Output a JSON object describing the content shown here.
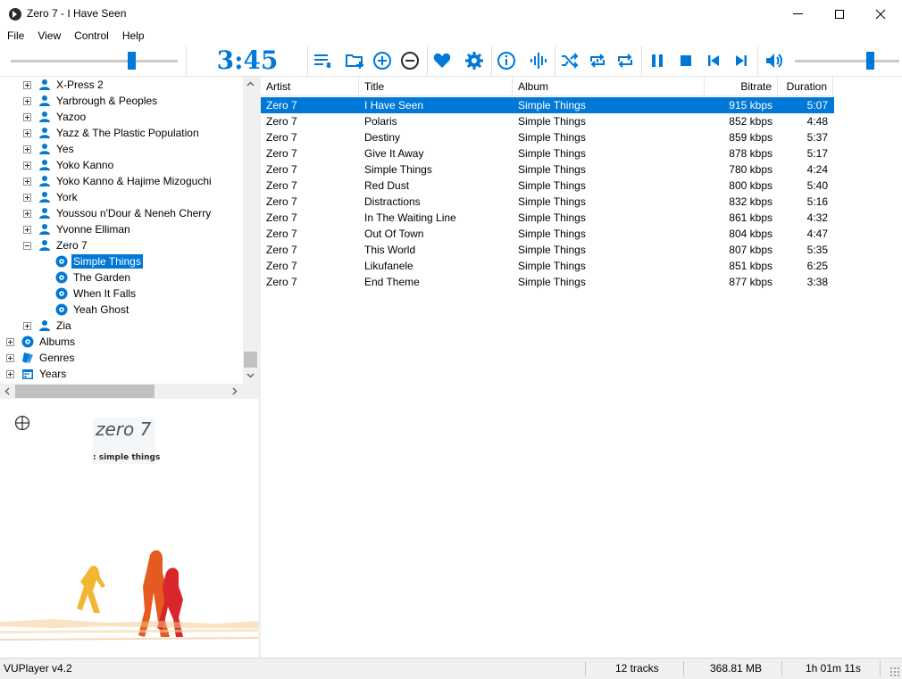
{
  "window": {
    "title": "Zero 7 - I Have Seen"
  },
  "menu": [
    "File",
    "View",
    "Control",
    "Help"
  ],
  "toolbar": {
    "counter": "3:45",
    "seek_fraction": 0.72,
    "volume_fraction": 0.72,
    "buttons": [
      "playlist-icon",
      "add-folder-icon",
      "add-icon",
      "remove-icon",
      "favourite-icon",
      "settings-icon",
      "info-icon",
      "visualiser-icon",
      "shuffle-icon",
      "repeat-track-icon",
      "repeat-playlist-icon",
      "pause-icon",
      "stop-icon",
      "previous-icon",
      "next-icon",
      "volume-icon"
    ],
    "accent": "#0078d7"
  },
  "tree": {
    "items": [
      {
        "label": "X-Press 2",
        "type": "artist",
        "expand": "plus",
        "level": 1
      },
      {
        "label": "Yarbrough & Peoples",
        "type": "artist",
        "expand": "plus",
        "level": 1
      },
      {
        "label": "Yazoo",
        "type": "artist",
        "expand": "plus",
        "level": 1
      },
      {
        "label": "Yazz & The Plastic Population",
        "type": "artist",
        "expand": "plus",
        "level": 1
      },
      {
        "label": "Yes",
        "type": "artist",
        "expand": "plus",
        "level": 1
      },
      {
        "label": "Yoko Kanno",
        "type": "artist",
        "expand": "plus",
        "level": 1
      },
      {
        "label": "Yoko Kanno & Hajime Mizoguchi",
        "type": "artist",
        "expand": "plus",
        "level": 1
      },
      {
        "label": "York",
        "type": "artist",
        "expand": "plus",
        "level": 1
      },
      {
        "label": "Youssou n'Dour & Neneh Cherry",
        "type": "artist",
        "expand": "plus",
        "level": 1
      },
      {
        "label": "Yvonne Elliman",
        "type": "artist",
        "expand": "plus",
        "level": 1
      },
      {
        "label": "Zero 7",
        "type": "artist",
        "expand": "minus",
        "level": 1
      },
      {
        "label": "Simple Things",
        "type": "album",
        "expand": "none",
        "level": 2,
        "selected": true
      },
      {
        "label": "The Garden",
        "type": "album",
        "expand": "none",
        "level": 2
      },
      {
        "label": "When It Falls",
        "type": "album",
        "expand": "none",
        "level": 2
      },
      {
        "label": "Yeah Ghost",
        "type": "album",
        "expand": "none",
        "level": 2
      },
      {
        "label": "Zia",
        "type": "artist",
        "expand": "plus",
        "level": 1
      },
      {
        "label": "Albums",
        "type": "albums",
        "expand": "plus",
        "level": 0
      },
      {
        "label": "Genres",
        "type": "genres",
        "expand": "plus",
        "level": 0
      },
      {
        "label": "Years",
        "type": "years",
        "expand": "plus",
        "level": 0
      }
    ]
  },
  "artwork": {
    "brand": "zero 7",
    "subtitle": ": simple things"
  },
  "playlist": {
    "columns": [
      "Artist",
      "Title",
      "Album",
      "Bitrate",
      "Duration"
    ],
    "rows": [
      {
        "artist": "Zero 7",
        "title": "I Have Seen",
        "album": "Simple Things",
        "bitrate": "915 kbps",
        "duration": "5:07",
        "selected": true
      },
      {
        "artist": "Zero 7",
        "title": "Polaris",
        "album": "Simple Things",
        "bitrate": "852 kbps",
        "duration": "4:48"
      },
      {
        "artist": "Zero 7",
        "title": "Destiny",
        "album": "Simple Things",
        "bitrate": "859 kbps",
        "duration": "5:37"
      },
      {
        "artist": "Zero 7",
        "title": "Give It Away",
        "album": "Simple Things",
        "bitrate": "878 kbps",
        "duration": "5:17"
      },
      {
        "artist": "Zero 7",
        "title": "Simple Things",
        "album": "Simple Things",
        "bitrate": "780 kbps",
        "duration": "4:24"
      },
      {
        "artist": "Zero 7",
        "title": "Red Dust",
        "album": "Simple Things",
        "bitrate": "800 kbps",
        "duration": "5:40"
      },
      {
        "artist": "Zero 7",
        "title": "Distractions",
        "album": "Simple Things",
        "bitrate": "832 kbps",
        "duration": "5:16"
      },
      {
        "artist": "Zero 7",
        "title": "In The Waiting Line",
        "album": "Simple Things",
        "bitrate": "861 kbps",
        "duration": "4:32"
      },
      {
        "artist": "Zero 7",
        "title": "Out Of Town",
        "album": "Simple Things",
        "bitrate": "804 kbps",
        "duration": "4:47"
      },
      {
        "artist": "Zero 7",
        "title": "This World",
        "album": "Simple Things",
        "bitrate": "807 kbps",
        "duration": "5:35"
      },
      {
        "artist": "Zero 7",
        "title": "Likufanele",
        "album": "Simple Things",
        "bitrate": "851 kbps",
        "duration": "6:25"
      },
      {
        "artist": "Zero 7",
        "title": "End Theme",
        "album": "Simple Things",
        "bitrate": "877 kbps",
        "duration": "3:38"
      }
    ]
  },
  "status": {
    "version": "VUPlayer v4.2",
    "tracks": "12 tracks",
    "size": "368.81 MB",
    "duration": "1h 01m 11s"
  }
}
